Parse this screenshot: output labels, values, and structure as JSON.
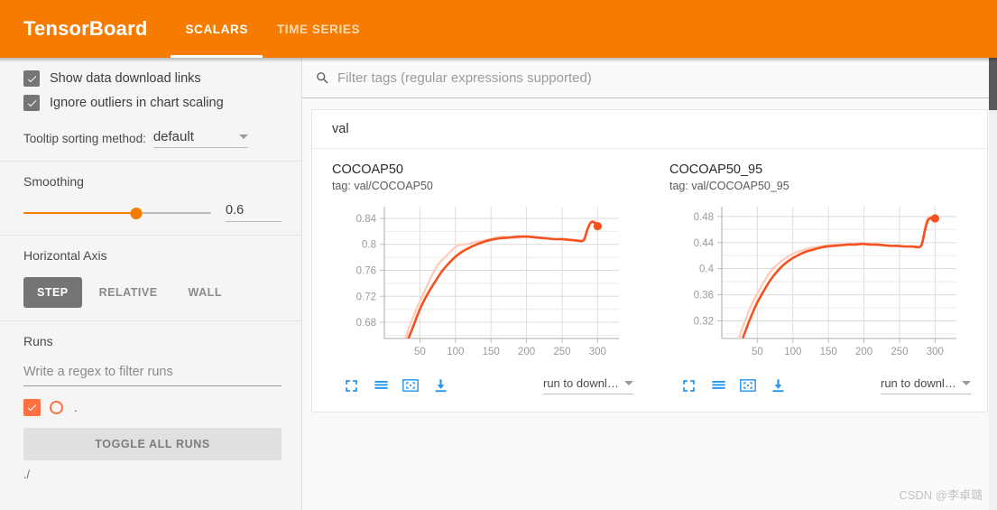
{
  "header": {
    "brand": "TensorBoard",
    "tabs": [
      {
        "label": "SCALARS",
        "active": true
      },
      {
        "label": "TIME SERIES",
        "active": false
      }
    ],
    "accent_color": "#f57c00"
  },
  "sidebar": {
    "checkboxes": [
      {
        "label": "Show data download links",
        "checked": true
      },
      {
        "label": "Ignore outliers in chart scaling",
        "checked": true
      }
    ],
    "tooltip": {
      "label": "Tooltip sorting method:",
      "value": "default"
    },
    "smoothing": {
      "title": "Smoothing",
      "value": "0.6",
      "percent": 60
    },
    "horizontal_axis": {
      "title": "Horizontal Axis",
      "options": [
        {
          "label": "STEP",
          "active": true
        },
        {
          "label": "RELATIVE",
          "active": false
        },
        {
          "label": "WALL",
          "active": false
        }
      ]
    },
    "runs": {
      "title": "Runs",
      "filter_placeholder": "Write a regex to filter runs",
      "filter_value": "",
      "run_name": ".",
      "run_checked": true,
      "run_color": "#ff7043",
      "toggle_all_label": "TOGGLE ALL RUNS",
      "run_path": "./"
    }
  },
  "search": {
    "placeholder": "Filter tags (regular expressions supported)",
    "value": "",
    "icon": "search-icon"
  },
  "card": {
    "group_title": "val"
  },
  "toolbar_icons": [
    {
      "name": "fullscreen-icon"
    },
    {
      "name": "data-series-icon"
    },
    {
      "name": "fit-domain-icon"
    },
    {
      "name": "download-icon"
    }
  ],
  "download_select": {
    "label": "run to downl…"
  },
  "chart_data": [
    {
      "type": "line",
      "title": "COCOAP50",
      "tag": "tag: val/COCOAP50",
      "xlabel": "",
      "ylabel": "",
      "grid": true,
      "legend": "none",
      "xticks": [
        50,
        100,
        150,
        200,
        250,
        300
      ],
      "yticks": [
        0.68,
        0.72,
        0.76,
        0.8,
        0.84
      ],
      "ytick_labels": [
        "0.68",
        "0.72",
        "0.76",
        "0.8",
        "0.84"
      ],
      "xlim": [
        0,
        330
      ],
      "ylim": [
        0.655,
        0.858
      ],
      "series": [
        {
          "name": "raw",
          "color": "#ffcbb8",
          "x": [
            25,
            35,
            45,
            55,
            65,
            75,
            85,
            95,
            105,
            115,
            125,
            135,
            145,
            155,
            165,
            175,
            185,
            195,
            205,
            215,
            225,
            235,
            245,
            255,
            265,
            275,
            281,
            285,
            290,
            295,
            300
          ],
          "y": [
            0.64,
            0.672,
            0.7,
            0.724,
            0.748,
            0.768,
            0.78,
            0.791,
            0.799,
            0.8,
            0.803,
            0.805,
            0.807,
            0.81,
            0.812,
            0.811,
            0.81,
            0.811,
            0.812,
            0.811,
            0.81,
            0.808,
            0.808,
            0.807,
            0.807,
            0.806,
            0.806,
            0.822,
            0.834,
            0.836,
            0.832
          ]
        },
        {
          "name": "smoothed",
          "color": "#f4511e",
          "x": [
            32,
            40,
            50,
            60,
            70,
            80,
            90,
            100,
            110,
            120,
            130,
            140,
            150,
            160,
            170,
            180,
            190,
            200,
            210,
            220,
            230,
            240,
            250,
            260,
            270,
            278,
            282,
            286,
            291,
            296,
            300
          ],
          "y": [
            0.65,
            0.672,
            0.7,
            0.722,
            0.74,
            0.757,
            0.77,
            0.781,
            0.789,
            0.795,
            0.8,
            0.804,
            0.807,
            0.809,
            0.81,
            0.811,
            0.812,
            0.812,
            0.811,
            0.81,
            0.809,
            0.808,
            0.808,
            0.807,
            0.806,
            0.805,
            0.81,
            0.824,
            0.834,
            0.833,
            0.828
          ]
        }
      ],
      "end_marker": {
        "x": 300,
        "y": 0.828,
        "color": "#f4511e"
      }
    },
    {
      "type": "line",
      "title": "COCOAP50_95",
      "tag": "tag: val/COCOAP50_95",
      "xlabel": "",
      "ylabel": "",
      "grid": true,
      "legend": "none",
      "xticks": [
        50,
        100,
        150,
        200,
        250,
        300
      ],
      "yticks": [
        0.32,
        0.36,
        0.4,
        0.44,
        0.48
      ],
      "ytick_labels": [
        "0.32",
        "0.36",
        "0.4",
        "0.44",
        "0.48"
      ],
      "xlim": [
        0,
        330
      ],
      "ylim": [
        0.293,
        0.495
      ],
      "series": [
        {
          "name": "raw",
          "color": "#ffcbb8",
          "x": [
            22,
            32,
            42,
            52,
            62,
            72,
            82,
            92,
            102,
            112,
            122,
            132,
            142,
            152,
            162,
            172,
            182,
            192,
            202,
            212,
            222,
            232,
            242,
            252,
            262,
            272,
            280,
            284,
            288,
            293,
            300
          ],
          "y": [
            0.288,
            0.318,
            0.345,
            0.366,
            0.385,
            0.4,
            0.41,
            0.418,
            0.424,
            0.428,
            0.431,
            0.433,
            0.435,
            0.436,
            0.437,
            0.437,
            0.438,
            0.438,
            0.438,
            0.437,
            0.436,
            0.435,
            0.435,
            0.434,
            0.434,
            0.434,
            0.434,
            0.452,
            0.474,
            0.48,
            0.477
          ]
        },
        {
          "name": "smoothed",
          "color": "#f4511e",
          "x": [
            30,
            38,
            48,
            58,
            68,
            78,
            88,
            98,
            108,
            118,
            128,
            138,
            148,
            158,
            168,
            178,
            188,
            198,
            208,
            218,
            228,
            238,
            248,
            258,
            268,
            278,
            282,
            286,
            290,
            295,
            300
          ],
          "y": [
            0.295,
            0.318,
            0.344,
            0.364,
            0.382,
            0.396,
            0.407,
            0.415,
            0.421,
            0.426,
            0.429,
            0.432,
            0.434,
            0.435,
            0.436,
            0.437,
            0.437,
            0.438,
            0.437,
            0.437,
            0.436,
            0.435,
            0.435,
            0.434,
            0.434,
            0.433,
            0.44,
            0.46,
            0.474,
            0.478,
            0.477
          ]
        }
      ],
      "end_marker": {
        "x": 300,
        "y": 0.477,
        "color": "#f4511e"
      }
    }
  ],
  "watermark": "CSDN @李卓璐"
}
